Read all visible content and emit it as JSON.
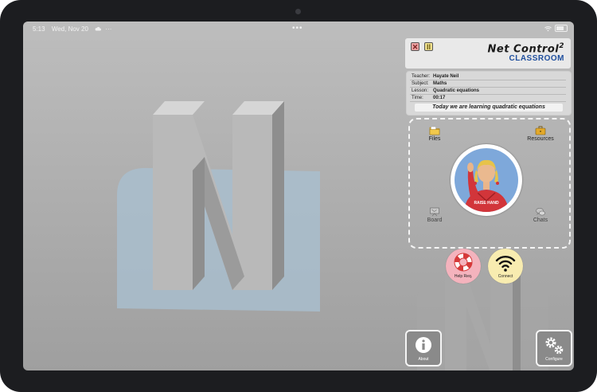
{
  "status": {
    "time": "5:13",
    "date": "Wed, Nov 20",
    "weather_icon": "cloud-icon",
    "more": "···",
    "center_dots": "•••"
  },
  "header": {
    "close_glyph": "✕",
    "pause_glyph": "II",
    "brand_name": "Net Control",
    "brand_sup": "2",
    "brand_sub": "CLASSROOM"
  },
  "session": {
    "rows": [
      {
        "label": "Teacher:",
        "value": "Hayate Neil"
      },
      {
        "label": "Subject:",
        "value": "Maths"
      },
      {
        "label": "Lesson:",
        "value": "Quadratic equations"
      },
      {
        "label": "Time:",
        "value": "00:17"
      }
    ],
    "banner": "Today we are learning quadratic equations"
  },
  "tiles": {
    "files": "Files",
    "resources": "Resources",
    "board": "Board",
    "chats": "Chats"
  },
  "raise_hand": "RAISE HAND",
  "buttons": {
    "help": "Help Req.",
    "connect": "Connect",
    "about": "About",
    "configure": "Configure"
  },
  "colors": {
    "brand_blue": "#1f4f9e",
    "help_pink": "#f4b3bd",
    "connect_yellow": "#f8ecb0",
    "avatar_bg": "#7ea8da"
  }
}
